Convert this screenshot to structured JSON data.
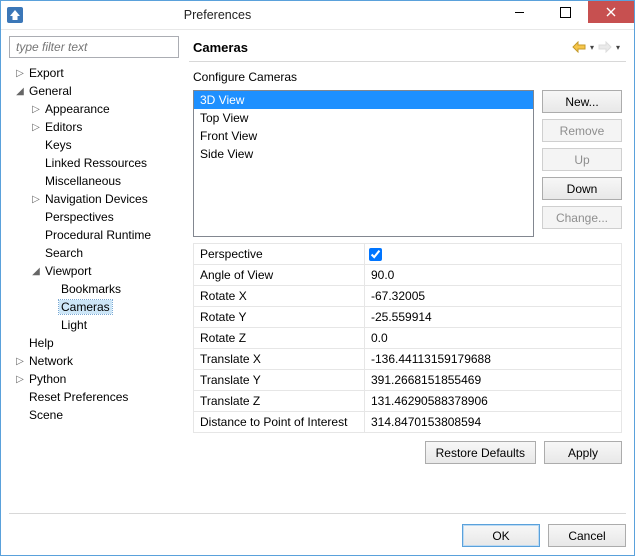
{
  "window": {
    "title": "Preferences"
  },
  "filter": {
    "placeholder": "type filter text"
  },
  "tree": [
    {
      "label": "Export",
      "indent": 0,
      "tw": "▷",
      "sel": false
    },
    {
      "label": "General",
      "indent": 0,
      "tw": "◢",
      "sel": false
    },
    {
      "label": "Appearance",
      "indent": 1,
      "tw": "▷",
      "sel": false
    },
    {
      "label": "Editors",
      "indent": 1,
      "tw": "▷",
      "sel": false
    },
    {
      "label": "Keys",
      "indent": 1,
      "tw": "",
      "sel": false
    },
    {
      "label": "Linked Ressources",
      "indent": 1,
      "tw": "",
      "sel": false
    },
    {
      "label": "Miscellaneous",
      "indent": 1,
      "tw": "",
      "sel": false
    },
    {
      "label": "Navigation Devices",
      "indent": 1,
      "tw": "▷",
      "sel": false
    },
    {
      "label": "Perspectives",
      "indent": 1,
      "tw": "",
      "sel": false
    },
    {
      "label": "Procedural Runtime",
      "indent": 1,
      "tw": "",
      "sel": false
    },
    {
      "label": "Search",
      "indent": 1,
      "tw": "",
      "sel": false
    },
    {
      "label": "Viewport",
      "indent": 1,
      "tw": "◢",
      "sel": false
    },
    {
      "label": "Bookmarks",
      "indent": 2,
      "tw": "",
      "sel": false
    },
    {
      "label": "Cameras",
      "indent": 2,
      "tw": "",
      "sel": true
    },
    {
      "label": "Light",
      "indent": 2,
      "tw": "",
      "sel": false
    },
    {
      "label": "Help",
      "indent": 0,
      "tw": "",
      "sel": false
    },
    {
      "label": "Network",
      "indent": 0,
      "tw": "▷",
      "sel": false
    },
    {
      "label": "Python",
      "indent": 0,
      "tw": "▷",
      "sel": false
    },
    {
      "label": "Reset Preferences",
      "indent": 0,
      "tw": "",
      "sel": false
    },
    {
      "label": "Scene",
      "indent": 0,
      "tw": "",
      "sel": false
    }
  ],
  "page": {
    "title": "Cameras",
    "subtitle": "Configure Cameras"
  },
  "cameras": {
    "items": [
      {
        "label": "3D View",
        "sel": true
      },
      {
        "label": "Top View",
        "sel": false
      },
      {
        "label": "Front View",
        "sel": false
      },
      {
        "label": "Side View",
        "sel": false
      }
    ]
  },
  "sidebtns": {
    "new": "New...",
    "remove": "Remove",
    "up": "Up",
    "down": "Down",
    "change": "Change..."
  },
  "props": [
    {
      "label": "Perspective",
      "type": "checkbox",
      "value": true
    },
    {
      "label": "Angle of View",
      "type": "text",
      "value": "90.0"
    },
    {
      "label": "Rotate X",
      "type": "text",
      "value": "-67.32005"
    },
    {
      "label": "Rotate Y",
      "type": "text",
      "value": "-25.559914"
    },
    {
      "label": "Rotate Z",
      "type": "text",
      "value": "0.0"
    },
    {
      "label": "Translate X",
      "type": "text",
      "value": "-136.44113159179688"
    },
    {
      "label": "Translate Y",
      "type": "text",
      "value": "391.2668151855469"
    },
    {
      "label": "Translate Z",
      "type": "text",
      "value": "131.46290588378906"
    },
    {
      "label": "Distance to Point of Interest",
      "type": "text",
      "value": "314.8470153808594"
    }
  ],
  "buttons": {
    "restore": "Restore Defaults",
    "apply": "Apply",
    "ok": "OK",
    "cancel": "Cancel"
  }
}
